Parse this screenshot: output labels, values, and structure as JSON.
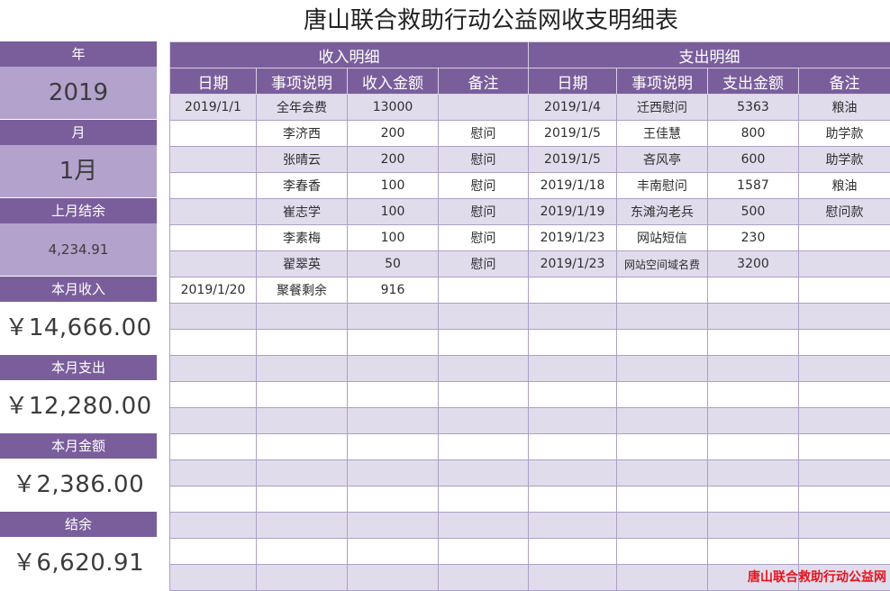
{
  "title": "唐山联合救助行动公益网收支明细表",
  "side": {
    "year_label": "年",
    "year_value": "2019",
    "month_label": "月",
    "month_value": "1月",
    "last_balance_label": "上月结余",
    "last_balance_value": "4,234.91",
    "income_label": "本月收入",
    "income_value": "￥14,666.00",
    "expense_label": "本月支出",
    "expense_value": "￥12,280.00",
    "amount_label": "本月金额",
    "amount_value": "￥2,386.00",
    "balance_label": "结余",
    "balance_value": "￥6,620.91"
  },
  "income": {
    "section_title": "收入明细",
    "headers": [
      "日期",
      "事项说明",
      "收入金额",
      "备注"
    ]
  },
  "expense": {
    "section_title": "支出明细",
    "headers": [
      "日期",
      "事项说明",
      "支出金额",
      "备注"
    ]
  },
  "rows": [
    {
      "in_date": "2019/1/1",
      "in_item": "全年会费",
      "in_amount": "13000",
      "in_note": "",
      "out_date": "2019/1/4",
      "out_item": "迁西慰问",
      "out_amount": "5363",
      "out_note": "粮油"
    },
    {
      "in_date": "",
      "in_item": "李济西",
      "in_amount": "200",
      "in_note": "慰问",
      "out_date": "2019/1/5",
      "out_item": "王佳慧",
      "out_amount": "800",
      "out_note": "助学款"
    },
    {
      "in_date": "",
      "in_item": "张晴云",
      "in_amount": "200",
      "in_note": "慰问",
      "out_date": "2019/1/5",
      "out_item": "吝风亭",
      "out_amount": "600",
      "out_note": "助学款"
    },
    {
      "in_date": "",
      "in_item": "李春香",
      "in_amount": "100",
      "in_note": "慰问",
      "out_date": "2019/1/18",
      "out_item": "丰南慰问",
      "out_amount": "1587",
      "out_note": "粮油"
    },
    {
      "in_date": "",
      "in_item": "崔志学",
      "in_amount": "100",
      "in_note": "慰问",
      "out_date": "2019/1/19",
      "out_item": "东滩沟老兵",
      "out_amount": "500",
      "out_note": "慰问款"
    },
    {
      "in_date": "",
      "in_item": "李素梅",
      "in_amount": "100",
      "in_note": "慰问",
      "out_date": "2019/1/23",
      "out_item": "网站短信",
      "out_amount": "230",
      "out_note": ""
    },
    {
      "in_date": "",
      "in_item": "翟翠英",
      "in_amount": "50",
      "in_note": "慰问",
      "out_date": "2019/1/23",
      "out_item": "网站空间域名费",
      "out_amount": "3200",
      "out_note": ""
    },
    {
      "in_date": "2019/1/20",
      "in_item": "聚餐剩余",
      "in_amount": "916",
      "in_note": "",
      "out_date": "",
      "out_item": "",
      "out_amount": "",
      "out_note": ""
    },
    {
      "in_date": "",
      "in_item": "",
      "in_amount": "",
      "in_note": "",
      "out_date": "",
      "out_item": "",
      "out_amount": "",
      "out_note": ""
    },
    {
      "in_date": "",
      "in_item": "",
      "in_amount": "",
      "in_note": "",
      "out_date": "",
      "out_item": "",
      "out_amount": "",
      "out_note": ""
    },
    {
      "in_date": "",
      "in_item": "",
      "in_amount": "",
      "in_note": "",
      "out_date": "",
      "out_item": "",
      "out_amount": "",
      "out_note": ""
    },
    {
      "in_date": "",
      "in_item": "",
      "in_amount": "",
      "in_note": "",
      "out_date": "",
      "out_item": "",
      "out_amount": "",
      "out_note": ""
    },
    {
      "in_date": "",
      "in_item": "",
      "in_amount": "",
      "in_note": "",
      "out_date": "",
      "out_item": "",
      "out_amount": "",
      "out_note": ""
    },
    {
      "in_date": "",
      "in_item": "",
      "in_amount": "",
      "in_note": "",
      "out_date": "",
      "out_item": "",
      "out_amount": "",
      "out_note": ""
    },
    {
      "in_date": "",
      "in_item": "",
      "in_amount": "",
      "in_note": "",
      "out_date": "",
      "out_item": "",
      "out_amount": "",
      "out_note": ""
    },
    {
      "in_date": "",
      "in_item": "",
      "in_amount": "",
      "in_note": "",
      "out_date": "",
      "out_item": "",
      "out_amount": "",
      "out_note": ""
    },
    {
      "in_date": "",
      "in_item": "",
      "in_amount": "",
      "in_note": "",
      "out_date": "",
      "out_item": "",
      "out_amount": "",
      "out_note": ""
    },
    {
      "in_date": "",
      "in_item": "",
      "in_amount": "",
      "in_note": "",
      "out_date": "",
      "out_item": "",
      "out_amount": "",
      "out_note": ""
    },
    {
      "in_date": "",
      "in_item": "",
      "in_amount": "",
      "in_note": "",
      "out_date": "",
      "out_item": "",
      "out_amount": "",
      "out_note": ""
    }
  ],
  "watermark": "唐山联合救助行动公益网",
  "colors": {
    "header_purple": "#7a5e9c",
    "side_value_lilac": "#b2a2cc",
    "row_stripe": "#e1dcec",
    "grid_line": "#ad9fc7",
    "watermark_red": "#e8121b"
  }
}
